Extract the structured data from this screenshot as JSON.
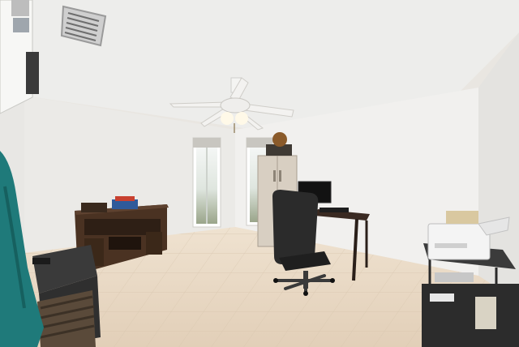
{
  "scene": {
    "kind": "photo",
    "room": "home office",
    "colors": {
      "ceiling": "#eeeeec",
      "wall_left": "#ebeae8",
      "wall_back": "#f0efed",
      "wall_right": "#e3e2df",
      "floor": "#e8d9c5",
      "wood": "#4a3222",
      "towel": "#1f7a7a",
      "chair": "#2b2b2b"
    },
    "objects": [
      "ceiling-fan",
      "air-vent",
      "window-left",
      "window-right",
      "tv-stand",
      "storage-cabinet",
      "computer-desk",
      "monitor",
      "office-chair",
      "printer",
      "printer-stand",
      "side-table",
      "towel",
      "laundry-basket",
      "wall-shelf"
    ]
  }
}
